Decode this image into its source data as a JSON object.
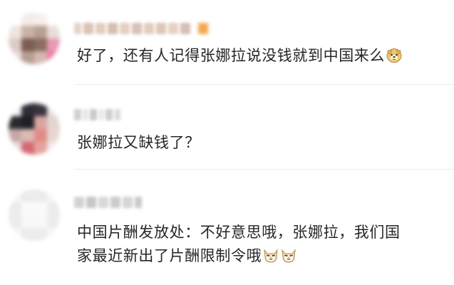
{
  "comments": [
    {
      "text": "好了，还有人记得张娜拉说没钱就到中国来么",
      "emoji_icons": [
        "doge-emoji-icon"
      ]
    },
    {
      "text": "张娜拉又缺钱了？"
    },
    {
      "lines": [
        "中国片酬发放处：不好意思哦，张娜拉，我们国",
        "家最近新出了片酬限制令哦"
      ],
      "emoji_icons": [
        "cat-face-emoji-icon",
        "cat-face-emoji-icon"
      ]
    }
  ],
  "colors": {
    "text": "#262626",
    "divider": "#ececec",
    "background": "#ffffff",
    "name_blur": "#d6c8bf",
    "badge": "#f2a950"
  }
}
